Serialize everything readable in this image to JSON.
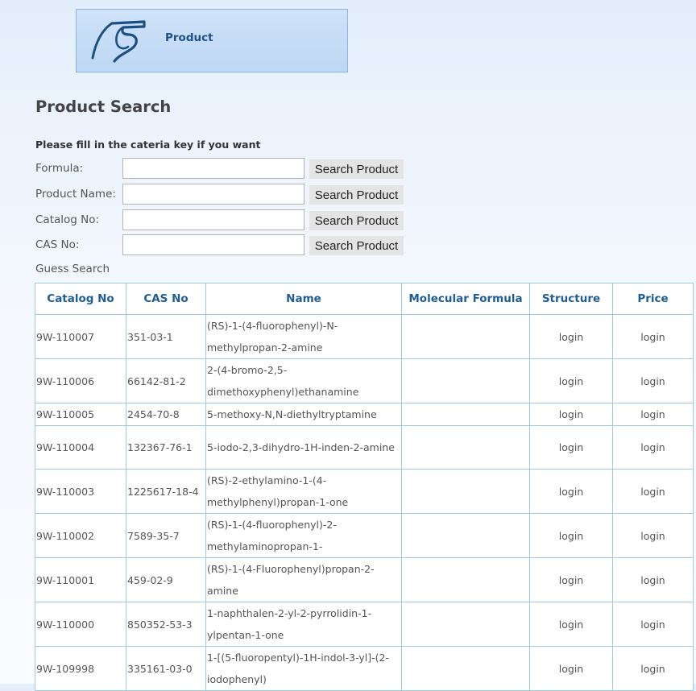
{
  "banner": {
    "title": "Product"
  },
  "page_title": "Product Search",
  "search": {
    "instructions": "Please fill in the cateria key if you want",
    "fields": [
      {
        "label": "Formula:",
        "value": "",
        "button": "Search Product"
      },
      {
        "label": "Product Name:",
        "value": "",
        "button": "Search Product"
      },
      {
        "label": "Catalog No:",
        "value": "",
        "button": "Search Product"
      },
      {
        "label": "CAS No:",
        "value": "",
        "button": "Search Product"
      }
    ],
    "guess_label": "Guess Search"
  },
  "table": {
    "headers": [
      "Catalog No",
      "CAS No",
      "Name",
      "Molecular Formula",
      "Structure",
      "Price"
    ],
    "rows": [
      {
        "catalog": "9W-110007",
        "cas": "351-03-1",
        "name": "(RS)-1-(4-fluorophenyl)-N-methylpropan-2-amine",
        "formula": "",
        "structure": "login",
        "price": "login"
      },
      {
        "catalog": "9W-110006",
        "cas": "66142-81-2",
        "name": "2-(4-bromo-2,5-dimethoxyphenyl)ethanamine",
        "formula": "",
        "structure": "login",
        "price": "login"
      },
      {
        "catalog": "9W-110005",
        "cas": "2454-70-8",
        "name": "5-methoxy-N,N-diethyltryptamine",
        "formula": "",
        "structure": "login",
        "price": "login"
      },
      {
        "catalog": "9W-110004",
        "cas": "132367-76-1",
        "name": "5-iodo-2,3-dihydro-1H-inden-2-amine",
        "formula": "",
        "structure": "login",
        "price": "login"
      },
      {
        "catalog": "9W-110003",
        "cas": "1225617-18-4",
        "name": "(RS)-2-ethylamino-1-(4-methylphenyl)propan-1-one",
        "formula": "",
        "structure": "login",
        "price": "login"
      },
      {
        "catalog": "9W-110002",
        "cas": "7589-35-7",
        "name": "(RS)-1-(4-fluorophenyl)-2-methylaminopropan-1-",
        "formula": "",
        "structure": "login",
        "price": "login"
      },
      {
        "catalog": "9W-110001",
        "cas": "459-02-9",
        "name": "(RS)-1-(4-Fluorophenyl)propan-2-amine",
        "formula": "",
        "structure": "login",
        "price": "login"
      },
      {
        "catalog": "9W-110000",
        "cas": "850352-53-3",
        "name": "1-naphthalen-2-yl-2-pyrrolidin-1-ylpentan-1-one",
        "formula": "",
        "structure": "login",
        "price": "login"
      },
      {
        "catalog": "9W-109998",
        "cas": "335161-03-0",
        "name": "1-[(5-fluoropentyl)-1H-indol-3-yl]-(2-iodophenyl)",
        "formula": "",
        "structure": "login",
        "price": "login"
      }
    ]
  },
  "colors": {
    "banner_bg": "#c8ddf6",
    "header_text": "#1e5d96",
    "table_border": "#9ccbe4"
  }
}
